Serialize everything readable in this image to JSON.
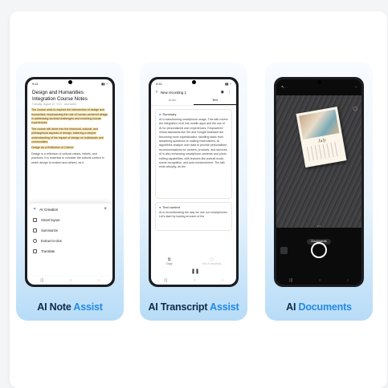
{
  "tiles": [
    {
      "label_a": "AI Note",
      "label_b": "Assist",
      "status": {
        "time": "9:41"
      },
      "doc_title": "Design and Humanities Integration Course Notes",
      "doc_meta": "Tuesday, August 13 · 9:41 · Last saved",
      "body": [
        "The course aims to explore the intersection of design and humanities, emphasizing the role of human-centered design in addressing societal challenges and enriching human experiences.",
        "The course will delve into the historical, cultural, and philosophical aspects of design, fostering a deeper understanding of the impact of design on individuals and communities.",
        "Design as a Reflection of Culture",
        "Design is a reflection of cultural values, beliefs, and practices. It is essential to consider the cultural context in which design is created and utilized, as it"
      ],
      "menu_title": "AI Creation",
      "menu_items": [
        "Smart layout",
        "Summarize",
        "Extract to-dos",
        "Translate"
      ]
    },
    {
      "label_a": "AI Transcript",
      "label_b": "Assist",
      "status": {
        "time": "9:41"
      },
      "header_title": "New recording 1",
      "tabs": [
        "Audio",
        "Text"
      ],
      "summary_label": "Summary",
      "summary_text": "AI is transforming smartphone usage. This talk covers the integration of AI into mobile apps and the use of AI for personalized user experiences. Empowered virtual assistants like Siri and Google Assistant are becoming more sophisticated, handling tasks from answering questions to making reservations. AI algorithms analyze user data to provide personalized recommendations for content, products, and services. AI is also enhancing smartphone cameras and photo editing capabilities, with features like portrait mode, scene recognition, and auto-enhancement. The talk ends abruptly, as the",
      "text_content_label": "Text content",
      "text_content": "AI is revolutionizing the way we use our smartphones. Let's start by looking at some of the",
      "bottom_left": "Copy",
      "bottom_right": "Ask AI anything"
    },
    {
      "label_a": "AI",
      "label_b": "Documents",
      "calendar_month": "July",
      "scan_chip": "Documents"
    }
  ]
}
